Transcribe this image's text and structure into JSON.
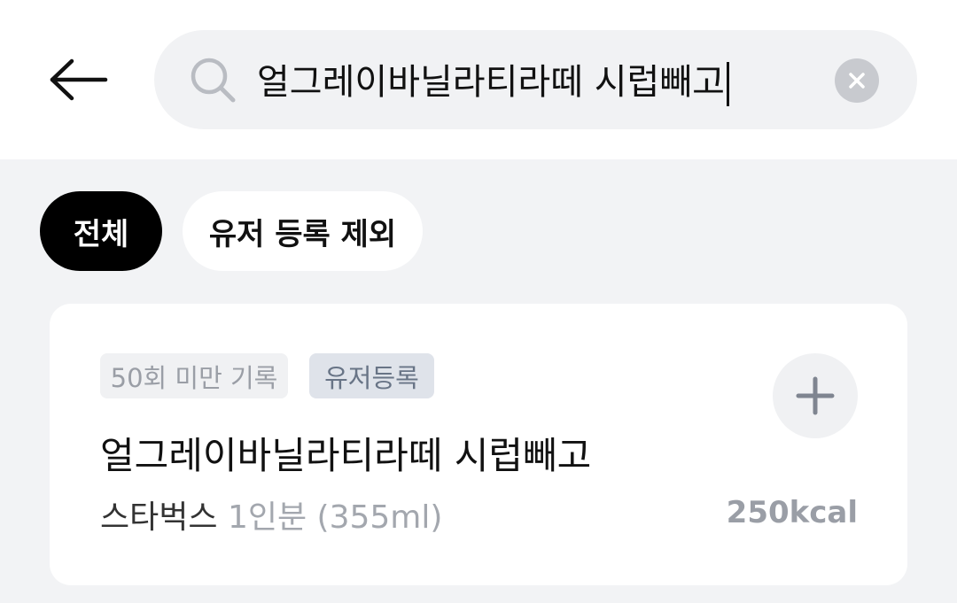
{
  "header": {
    "back_icon": "arrow-left-icon",
    "search": {
      "value": "얼그레이바닐라티라떼 시럽빼고",
      "icon": "search-icon",
      "clear_icon": "clear-icon"
    }
  },
  "filters": [
    {
      "label": "전체",
      "selected": true
    },
    {
      "label": "유저 등록 제외",
      "selected": false
    }
  ],
  "results": [
    {
      "badges": [
        "50회 미만 기록",
        "유저등록"
      ],
      "name": "얼그레이바닐라티라떼 시럽빼고",
      "brand": "스타벅스",
      "serving": "1인분 (355ml)",
      "kcal": "250kcal",
      "add_icon": "plus-icon"
    }
  ],
  "colors": {
    "background": "#f2f3f5",
    "chip_selected": "#000000",
    "badge_user_bg": "#dfe3ea",
    "badge_user_text": "#687486",
    "muted_text": "#9a9ea6"
  }
}
